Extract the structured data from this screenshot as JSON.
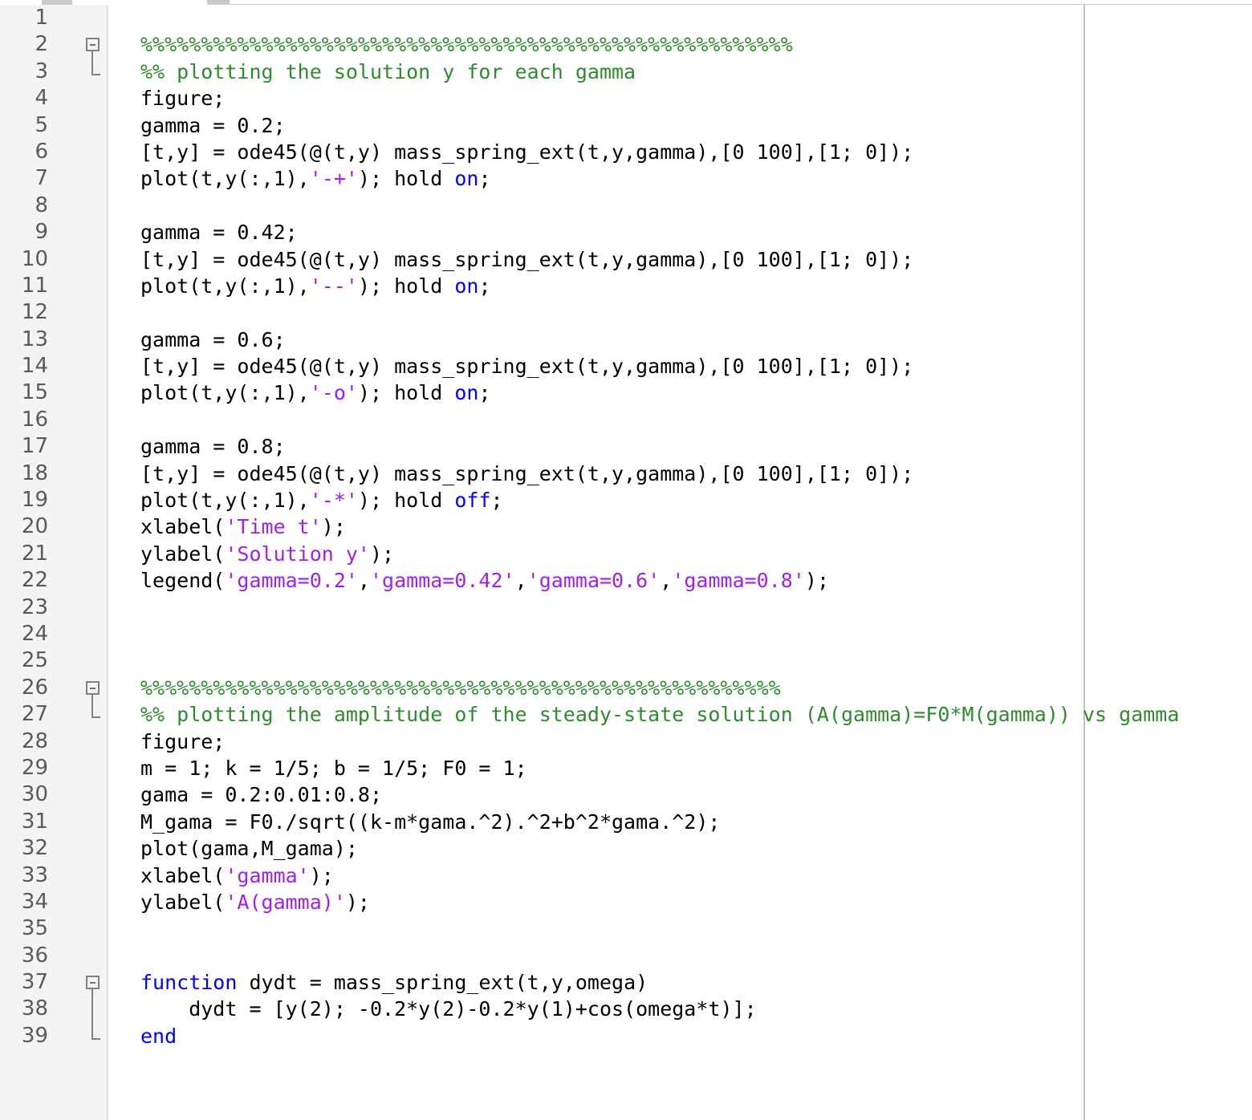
{
  "editor": {
    "app": "matlab-code-editor",
    "line_count": 39,
    "colors": {
      "comment": "#2E8B2E",
      "string": "#A020F0",
      "keyword": "#0000FF",
      "plain": "#000000",
      "gutter_bg": "#f4f4f4",
      "lineno_text": "#5a5a5a",
      "limit_rule": "#c2c2c2"
    },
    "line_numbers": [
      "1",
      "2",
      "3",
      "4",
      "5",
      "6",
      "7",
      "8",
      "9",
      "10",
      "11",
      "12",
      "13",
      "14",
      "15",
      "16",
      "17",
      "18",
      "19",
      "20",
      "21",
      "22",
      "23",
      "24",
      "25",
      "26",
      "27",
      "28",
      "29",
      "30",
      "31",
      "32",
      "33",
      "34",
      "35",
      "36",
      "37",
      "38",
      "39"
    ],
    "fold_markers": [
      {
        "line": 2,
        "stem_lines": 1,
        "type": "section-fold"
      },
      {
        "line": 26,
        "stem_lines": 1,
        "type": "section-fold"
      },
      {
        "line": 37,
        "stem_lines": 2,
        "type": "function-fold"
      }
    ],
    "lines": [
      {
        "n": 1,
        "tokens": []
      },
      {
        "n": 2,
        "tokens": [
          {
            "t": "comment",
            "s": "%%%%%%%%%%%%%%%%%%%%%%%%%%%%%%%%%%%%%%%%%%%%%%%%%%%%%%"
          }
        ]
      },
      {
        "n": 3,
        "tokens": [
          {
            "t": "comment",
            "s": "%% plotting the solution y for each gamma"
          }
        ]
      },
      {
        "n": 4,
        "tokens": [
          {
            "t": "plain",
            "s": "figure;"
          }
        ]
      },
      {
        "n": 5,
        "tokens": [
          {
            "t": "plain",
            "s": "gamma = 0.2;"
          }
        ]
      },
      {
        "n": 6,
        "tokens": [
          {
            "t": "plain",
            "s": "[t,y] = ode45(@(t,y) mass_spring_ext(t,y,gamma),[0 100],[1; 0]);"
          }
        ]
      },
      {
        "n": 7,
        "tokens": [
          {
            "t": "plain",
            "s": "plot(t,y(:,1),"
          },
          {
            "t": "string",
            "s": "'-+'"
          },
          {
            "t": "plain",
            "s": "); hold "
          },
          {
            "t": "keyword",
            "s": "on"
          },
          {
            "t": "plain",
            "s": ";"
          }
        ]
      },
      {
        "n": 8,
        "tokens": []
      },
      {
        "n": 9,
        "tokens": [
          {
            "t": "plain",
            "s": "gamma = 0.42;"
          }
        ]
      },
      {
        "n": 10,
        "tokens": [
          {
            "t": "plain",
            "s": "[t,y] = ode45(@(t,y) mass_spring_ext(t,y,gamma),[0 100],[1; 0]);"
          }
        ]
      },
      {
        "n": 11,
        "tokens": [
          {
            "t": "plain",
            "s": "plot(t,y(:,1),"
          },
          {
            "t": "string",
            "s": "'--'"
          },
          {
            "t": "plain",
            "s": "); hold "
          },
          {
            "t": "keyword",
            "s": "on"
          },
          {
            "t": "plain",
            "s": ";"
          }
        ]
      },
      {
        "n": 12,
        "tokens": []
      },
      {
        "n": 13,
        "tokens": [
          {
            "t": "plain",
            "s": "gamma = 0.6;"
          }
        ]
      },
      {
        "n": 14,
        "tokens": [
          {
            "t": "plain",
            "s": "[t,y] = ode45(@(t,y) mass_spring_ext(t,y,gamma),[0 100],[1; 0]);"
          }
        ]
      },
      {
        "n": 15,
        "tokens": [
          {
            "t": "plain",
            "s": "plot(t,y(:,1),"
          },
          {
            "t": "string",
            "s": "'-o'"
          },
          {
            "t": "plain",
            "s": "); hold "
          },
          {
            "t": "keyword",
            "s": "on"
          },
          {
            "t": "plain",
            "s": ";"
          }
        ]
      },
      {
        "n": 16,
        "tokens": []
      },
      {
        "n": 17,
        "tokens": [
          {
            "t": "plain",
            "s": "gamma = 0.8;"
          }
        ]
      },
      {
        "n": 18,
        "tokens": [
          {
            "t": "plain",
            "s": "[t,y] = ode45(@(t,y) mass_spring_ext(t,y,gamma),[0 100],[1; 0]);"
          }
        ]
      },
      {
        "n": 19,
        "tokens": [
          {
            "t": "plain",
            "s": "plot(t,y(:,1),"
          },
          {
            "t": "string",
            "s": "'-*'"
          },
          {
            "t": "plain",
            "s": "); hold "
          },
          {
            "t": "keyword",
            "s": "off"
          },
          {
            "t": "plain",
            "s": ";"
          }
        ]
      },
      {
        "n": 20,
        "tokens": [
          {
            "t": "plain",
            "s": "xlabel("
          },
          {
            "t": "string",
            "s": "'Time t'"
          },
          {
            "t": "plain",
            "s": ");"
          }
        ]
      },
      {
        "n": 21,
        "tokens": [
          {
            "t": "plain",
            "s": "ylabel("
          },
          {
            "t": "string",
            "s": "'Solution y'"
          },
          {
            "t": "plain",
            "s": ");"
          }
        ]
      },
      {
        "n": 22,
        "tokens": [
          {
            "t": "plain",
            "s": "legend("
          },
          {
            "t": "string",
            "s": "'gamma=0.2'"
          },
          {
            "t": "plain",
            "s": ","
          },
          {
            "t": "string",
            "s": "'gamma=0.42'"
          },
          {
            "t": "plain",
            "s": ","
          },
          {
            "t": "string",
            "s": "'gamma=0.6'"
          },
          {
            "t": "plain",
            "s": ","
          },
          {
            "t": "string",
            "s": "'gamma=0.8'"
          },
          {
            "t": "plain",
            "s": ");"
          }
        ]
      },
      {
        "n": 23,
        "tokens": []
      },
      {
        "n": 24,
        "tokens": []
      },
      {
        "n": 25,
        "tokens": []
      },
      {
        "n": 26,
        "tokens": [
          {
            "t": "comment",
            "s": "%%%%%%%%%%%%%%%%%%%%%%%%%%%%%%%%%%%%%%%%%%%%%%%%%%%%%"
          }
        ]
      },
      {
        "n": 27,
        "tokens": [
          {
            "t": "comment",
            "s": "%% plotting the amplitude of the steady-state solution (A(gamma)=F0*M(gamma)) vs gamma"
          }
        ]
      },
      {
        "n": 28,
        "tokens": [
          {
            "t": "plain",
            "s": "figure;"
          }
        ]
      },
      {
        "n": 29,
        "tokens": [
          {
            "t": "plain",
            "s": "m = 1; k = 1/5; b = 1/5; F0 = 1;"
          }
        ]
      },
      {
        "n": 30,
        "tokens": [
          {
            "t": "plain",
            "s": "gama = 0.2:0.01:0.8;"
          }
        ]
      },
      {
        "n": 31,
        "tokens": [
          {
            "t": "plain",
            "s": "M_gama = F0./sqrt((k-m*gama.^2).^2+b^2*gama.^2);"
          }
        ]
      },
      {
        "n": 32,
        "tokens": [
          {
            "t": "plain",
            "s": "plot(gama,M_gama);"
          }
        ]
      },
      {
        "n": 33,
        "tokens": [
          {
            "t": "plain",
            "s": "xlabel("
          },
          {
            "t": "string",
            "s": "'gamma'"
          },
          {
            "t": "plain",
            "s": ");"
          }
        ]
      },
      {
        "n": 34,
        "tokens": [
          {
            "t": "plain",
            "s": "ylabel("
          },
          {
            "t": "string",
            "s": "'A(gamma)'"
          },
          {
            "t": "plain",
            "s": ");"
          }
        ]
      },
      {
        "n": 35,
        "tokens": []
      },
      {
        "n": 36,
        "tokens": []
      },
      {
        "n": 37,
        "tokens": [
          {
            "t": "keyword",
            "s": "function"
          },
          {
            "t": "plain",
            "s": " dydt = mass_spring_ext(t,y,omega)"
          }
        ]
      },
      {
        "n": 38,
        "tokens": [
          {
            "t": "plain",
            "s": "    dydt = [y(2); -0.2*y(2)-0.2*y(1)+cos(omega*t)];"
          }
        ]
      },
      {
        "n": 39,
        "tokens": [
          {
            "t": "keyword",
            "s": "end"
          }
        ]
      }
    ]
  }
}
